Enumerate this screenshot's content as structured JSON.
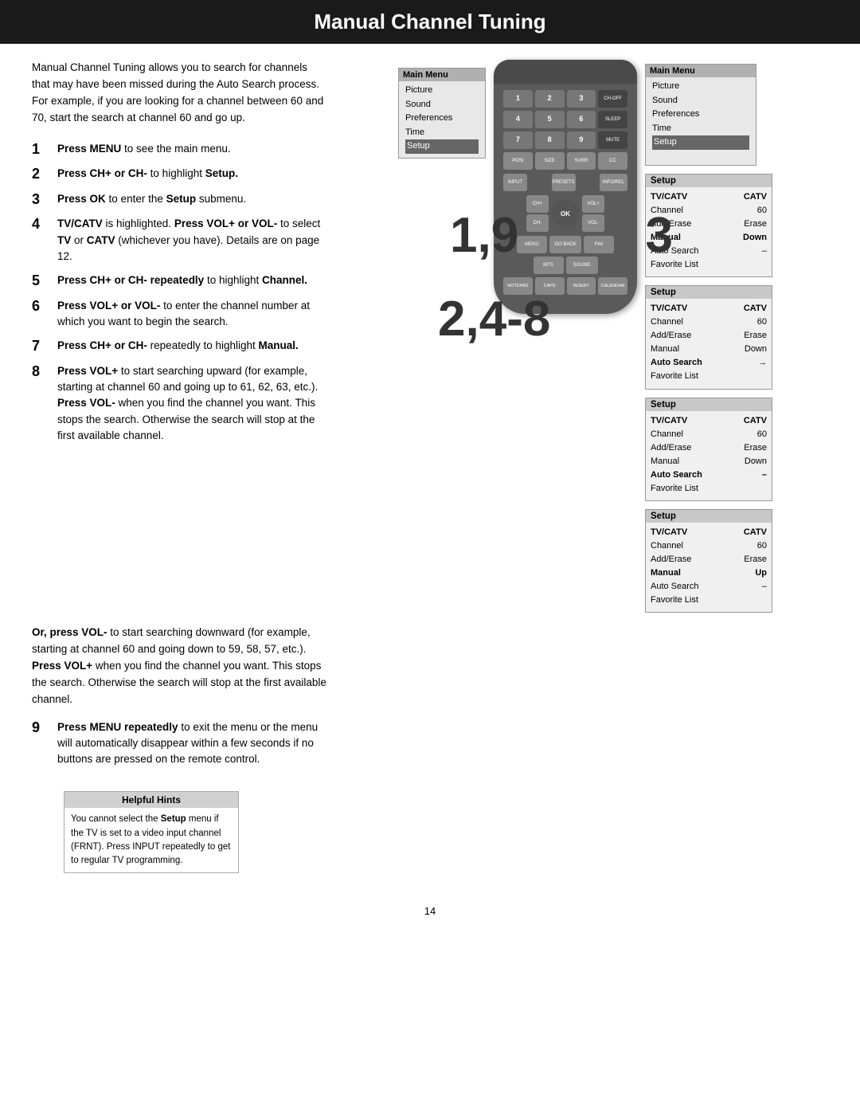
{
  "title": "Manual Channel Tuning",
  "intro": "Manual Channel Tuning allows you to search for channels that may have been missed during the Auto Search process. For example, if you are looking for a channel between 60 and 70, start the search at channel 60 and go up.",
  "steps": [
    {
      "num": "1",
      "text": "Press MENU to see the main menu.",
      "bold_parts": [
        "MENU"
      ]
    },
    {
      "num": "2",
      "text": "Press CH+ or CH- to highlight Setup.",
      "bold_parts": [
        "CH+ or CH-",
        "Setup"
      ]
    },
    {
      "num": "3",
      "text": "Press OK to enter the Setup submenu.",
      "bold_parts": [
        "OK",
        "Setup"
      ]
    },
    {
      "num": "4",
      "text": "TV/CATV is highlighted. Press VOL+ or VOL- to select TV or CATV (whichever you have). Details are on page 12.",
      "bold_parts": [
        "TV/CATV",
        "VOL+ or",
        "VOL-",
        "TV",
        "CATV"
      ]
    },
    {
      "num": "5",
      "text": "Press CH+ or CH- repeatedly to highlight Channel.",
      "bold_parts": [
        "CH+ or CH- repeatedly",
        "Channel"
      ]
    },
    {
      "num": "6",
      "text": "Press VOL+ or VOL- to enter the channel number at which you want to begin the search.",
      "bold_parts": [
        "VOL+ or VOL-"
      ]
    },
    {
      "num": "7",
      "text": "Press CH+ or CH- repeatedly to highlight Manual.",
      "bold_parts": [
        "CH+ or CH-",
        "Manual"
      ]
    },
    {
      "num": "8",
      "text": "Press VOL+ to start searching upward (for example, starting at channel 60 and going up to 61, 62, 63, etc.). Press VOL- when you find the channel you want. This stops the search. Otherwise the search will stop at the first available channel.",
      "bold_parts": [
        "VOL+",
        "VOL-"
      ]
    }
  ],
  "or_press_text": "Or, press VOL- to start searching downward (for example, starting at channel 60 and going down to 59, 58, 57, etc.). Press VOL+ when you find the channel you want. This stops the search. Otherwise the search will stop at the first available channel.",
  "step_9": {
    "num": "9",
    "text": "Press MENU repeatedly to exit the menu or the menu will automatically disappear within a few seconds if no buttons are pressed on the remote control.",
    "bold_parts": [
      "MENU repeatedly"
    ]
  },
  "step_numbers_overlay": {
    "left_19": "1,9",
    "left_248": "2,4-8",
    "right_3": "3"
  },
  "main_menu_left": {
    "title": "Main Menu",
    "items": [
      "Picture",
      "Sound",
      "Preferences",
      "Time",
      "Setup"
    ],
    "highlighted": "Setup"
  },
  "main_menu_right": {
    "title": "Main Menu",
    "items": [
      "Picture",
      "Sound",
      "Preferences",
      "Time",
      "Setup"
    ]
  },
  "setup_boxes": [
    {
      "title": "Setup",
      "rows": [
        {
          "label": "TV/CATV",
          "value": "CATV",
          "bold": true
        },
        {
          "label": "Channel",
          "value": "60"
        },
        {
          "label": "Add/Erase",
          "value": "Erase"
        },
        {
          "label": "Manual",
          "value": "Down",
          "bold": true
        },
        {
          "label": "Auto Search",
          "value": "–"
        },
        {
          "label": "Favorite List",
          "value": ""
        }
      ]
    },
    {
      "title": "Setup",
      "rows": [
        {
          "label": "TV/CATV",
          "value": "CATV",
          "bold": true
        },
        {
          "label": "Channel",
          "value": "60"
        },
        {
          "label": "Add/Erase",
          "value": "Erase"
        },
        {
          "label": "Manual",
          "value": "Down"
        },
        {
          "label": "Auto Search",
          "value": "→",
          "bold": true
        },
        {
          "label": "Favorite List",
          "value": ""
        }
      ]
    },
    {
      "title": "Setup",
      "rows": [
        {
          "label": "TV/CATV",
          "value": "CATV",
          "bold": true
        },
        {
          "label": "Channel",
          "value": "60"
        },
        {
          "label": "Add/Erase",
          "value": "Erase"
        },
        {
          "label": "Manual",
          "value": "Down"
        },
        {
          "label": "Auto Search",
          "value": "–",
          "bold": true
        },
        {
          "label": "Favorite List",
          "value": ""
        }
      ]
    },
    {
      "title": "Setup",
      "rows": [
        {
          "label": "TV/CATV",
          "value": "CATV",
          "bold": true
        },
        {
          "label": "Channel",
          "value": "60"
        },
        {
          "label": "Add/Erase",
          "value": "Erase"
        },
        {
          "label": "Manual",
          "value": "Up",
          "bold": true
        },
        {
          "label": "Auto Search",
          "value": "–"
        },
        {
          "label": "Favorite List",
          "value": ""
        }
      ]
    }
  ],
  "helpful_hints": {
    "title": "Helpful Hints",
    "text": "You cannot select the Setup menu if the TV is set to a video input channel (FRNT). Press INPUT repeatedly to get to regular TV programming."
  },
  "page_number": "14",
  "remote": {
    "row1_buttons": [
      "1",
      "2",
      "3",
      "CH-OFF"
    ],
    "row2_buttons": [
      "4",
      "5",
      "6",
      "SLEEP"
    ],
    "row3_buttons": [
      "7",
      "8",
      "9",
      "MUTE"
    ],
    "row4_buttons": [
      "POSI",
      "SIZE",
      "SURR",
      "CC"
    ],
    "nav_up": "CH+",
    "nav_down": "CH-",
    "nav_left": "VOL-",
    "nav_right": "VOL+",
    "nav_ok": "OK",
    "bottom_row": [
      "MENU",
      "▼",
      "▲",
      "OK"
    ],
    "vol_minus": "VOL-",
    "vol_plus": "VOL+",
    "ch_minus": "CH-",
    "ch_plus": "CH+",
    "extra_buttons": [
      "MTS",
      "SOUND",
      "NOTEPAD",
      "CAPS",
      "INSERT",
      "CALENDAR"
    ]
  }
}
